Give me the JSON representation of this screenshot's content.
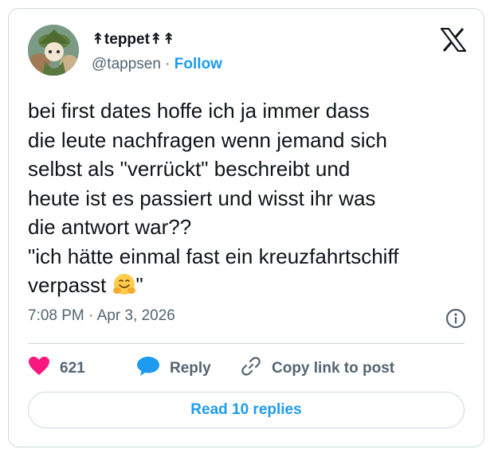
{
  "author": {
    "display_name": "↟teppet↟↟",
    "handle": "@tappsen",
    "separator": "·",
    "follow_label": "Follow"
  },
  "tweet": {
    "lines": [
      "bei first dates hoffe ich ja immer dass",
      "die leute nachfragen wenn jemand sich",
      "selbst als \"verrückt\" beschreibt und",
      "heute ist es passiert und wisst ihr was",
      "die antwort war??",
      "\"ich hätte einmal fast ein kreuzfahrtschiff",
      "verpasst "
    ],
    "closing_quote": "\"",
    "emoji_name": "hugging-face"
  },
  "meta": {
    "timestamp": "7:08 PM · Apr 3, 2026"
  },
  "actions": {
    "likes": "621",
    "reply_label": "Reply",
    "copy_label": "Copy link to post"
  },
  "read_replies_label": "Read 10 replies",
  "icons": {
    "like": "heart-icon",
    "reply": "speech-bubble-icon",
    "copy": "link-icon",
    "info": "info-icon",
    "brand": "x-logo"
  },
  "colors": {
    "accent": "#1d9bf0",
    "like": "#f91880",
    "text": "#0f1419",
    "muted": "#536471",
    "border": "#cfd9de"
  }
}
